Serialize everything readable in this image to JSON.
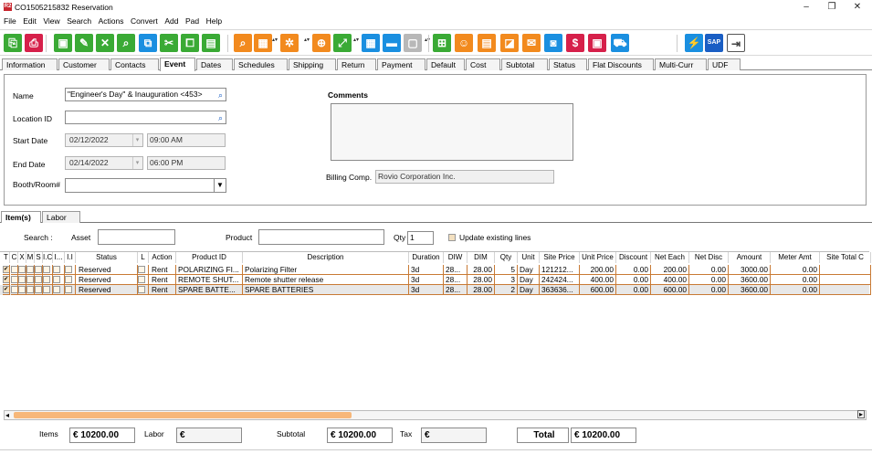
{
  "window": {
    "app_icon": "R2",
    "title": "CO1505215832 Reservation",
    "controls": [
      "–",
      "❐",
      "✕"
    ]
  },
  "menu": [
    "File",
    "Edit",
    "View",
    "Search",
    "Actions",
    "Convert",
    "Add",
    "Pad",
    "Help"
  ],
  "toolbar": {
    "icons": [
      {
        "name": "new-document-icon",
        "glyph": "⎘",
        "color": "#3aaa35"
      },
      {
        "name": "print-icon",
        "glyph": "⎙",
        "color": "#d6204a"
      },
      {
        "name": "save-icon",
        "glyph": "▣",
        "color": "#3aaa35"
      },
      {
        "name": "edit-icon",
        "glyph": "✎",
        "color": "#3aaa35"
      },
      {
        "name": "delete-icon",
        "glyph": "✕",
        "color": "#3aaa35"
      },
      {
        "name": "search-icon",
        "glyph": "⌕",
        "color": "#3aaa35"
      },
      {
        "name": "copy-icon",
        "glyph": "⧉",
        "color": "#1a8fe0"
      },
      {
        "name": "cut-icon",
        "glyph": "✂",
        "color": "#3aaa35"
      },
      {
        "name": "duplicate-icon",
        "glyph": "⧠",
        "color": "#3aaa35"
      },
      {
        "name": "clipboard-icon",
        "glyph": "▤",
        "color": "#3aaa35"
      },
      {
        "name": "search-box-icon",
        "glyph": "⌕",
        "color": "#f28a1e"
      },
      {
        "name": "calendar-icon",
        "glyph": "▦",
        "color": "#f28a1e"
      },
      {
        "name": "group-icon",
        "glyph": "✲",
        "color": "#f28a1e"
      },
      {
        "name": "add-cart-icon",
        "glyph": "⊕",
        "color": "#f28a1e"
      },
      {
        "name": "expand-icon",
        "glyph": "⤢",
        "color": "#3aaa35"
      },
      {
        "name": "grid-icon",
        "glyph": "▦",
        "color": "#1a8fe0"
      },
      {
        "name": "message-icon",
        "glyph": "▬",
        "color": "#1a8fe0"
      },
      {
        "name": "disabled-icon",
        "glyph": "▢",
        "color": "#b8b8b8"
      },
      {
        "name": "hierarchy-icon",
        "glyph": "⊞",
        "color": "#3aaa35"
      },
      {
        "name": "smiley-icon",
        "glyph": "☺",
        "color": "#f28a1e"
      },
      {
        "name": "document-icon",
        "glyph": "▤",
        "color": "#f28a1e"
      },
      {
        "name": "note-icon",
        "glyph": "◪",
        "color": "#f28a1e"
      },
      {
        "name": "email-icon",
        "glyph": "✉",
        "color": "#f28a1e"
      },
      {
        "name": "chat-icon",
        "glyph": "◙",
        "color": "#1a8fe0"
      },
      {
        "name": "money-icon",
        "glyph": "$",
        "color": "#d6204a"
      },
      {
        "name": "picture-icon",
        "glyph": "▣",
        "color": "#d6204a"
      },
      {
        "name": "truck-icon",
        "glyph": "⛟",
        "color": "#1a8fe0"
      },
      {
        "name": "lightning-icon",
        "glyph": "⚡",
        "color": "#1a8fe0"
      },
      {
        "name": "sap-icon",
        "glyph": "SAP",
        "color": "#1a5ec4"
      },
      {
        "name": "exit-icon",
        "glyph": "⇥",
        "color": "#ffffff"
      }
    ]
  },
  "tabs": [
    "Information",
    "Customer",
    "Contacts",
    "Event",
    "Dates",
    "Schedules",
    "Shipping",
    "Return",
    "Payment",
    "Default",
    "Cost",
    "Subtotal",
    "Status",
    "Flat Discounts",
    "Multi-Curr",
    "UDF"
  ],
  "active_tab": "Event",
  "event": {
    "name_label": "Name",
    "name_value": "\"Engineer's Day\" & Inauguration <453>",
    "location_label": "Location ID",
    "location_value": "",
    "start_label": "Start Date",
    "start_date": "02/12/2022",
    "start_time": "09:00 AM",
    "end_label": "End Date",
    "end_date": "02/14/2022",
    "end_time": "06:00 PM",
    "booth_label": "Booth/Room#",
    "booth_value": "",
    "comments_label": "Comments",
    "comments_value": "",
    "billing_label": "Billing Comp.",
    "billing_value": "Rovio Corporation Inc."
  },
  "subtabs": [
    "Item(s)",
    "Labor"
  ],
  "search_bar": {
    "search_label": "Search :",
    "asset_label": "Asset",
    "asset_value": "",
    "product_label": "Product",
    "product_value": "",
    "qty_label": "Qty",
    "qty_value": "1",
    "update_label": "Update existing lines"
  },
  "grid": {
    "columns": [
      "T",
      "C",
      "X",
      "M",
      "S",
      "I.C",
      "I...",
      "I.I",
      "Status",
      "L",
      "Action",
      "Product ID",
      "Description",
      "Duration",
      "DIW",
      "DIM",
      "Qty",
      "Unit",
      "Site Price",
      "Unit Price",
      "Discount",
      "Net Each",
      "Net Disc",
      "Amount",
      "Meter Amt",
      "Site Total C"
    ],
    "rows": [
      {
        "status": "Reserved",
        "action": "Rent",
        "product_id": "POLARIZING FI...",
        "description": "Polarizing Filter",
        "duration": "3d",
        "diw": "28...",
        "dim": "28.00",
        "qty": "5",
        "unit": "Day",
        "site_price": "121212...",
        "unit_price": "200.00",
        "discount": "0.00",
        "net_each": "200.00",
        "net_disc": "0.00",
        "amount": "3000.00",
        "meter_amt": "0.00"
      },
      {
        "status": "Reserved",
        "action": "Rent",
        "product_id": "REMOTE SHUT...",
        "description": "Remote shutter release",
        "duration": "3d",
        "diw": "28...",
        "dim": "28.00",
        "qty": "3",
        "unit": "Day",
        "site_price": "242424...",
        "unit_price": "400.00",
        "discount": "0.00",
        "net_each": "400.00",
        "net_disc": "0.00",
        "amount": "3600.00",
        "meter_amt": "0.00"
      },
      {
        "status": "Reserved",
        "action": "Rent",
        "product_id": "SPARE BATTE...",
        "description": "SPARE BATTERIES",
        "duration": "3d",
        "diw": "28...",
        "dim": "28.00",
        "qty": "2",
        "unit": "Day",
        "site_price": "363636...",
        "unit_price": "600.00",
        "discount": "0.00",
        "net_each": "600.00",
        "net_disc": "0.00",
        "amount": "3600.00",
        "meter_amt": "0.00"
      }
    ]
  },
  "scrollbar": {
    "left_arrow": "◂",
    "right_arrow": "▸"
  },
  "totals": {
    "items_label": "Items",
    "items_value": "€ 10200.00",
    "labor_label": "Labor",
    "labor_value": "€",
    "subtotal_label": "Subtotal",
    "subtotal_value": "€ 10200.00",
    "tax_label": "Tax",
    "tax_value": "€",
    "total_label": "Total",
    "total_value": "€ 10200.00"
  }
}
